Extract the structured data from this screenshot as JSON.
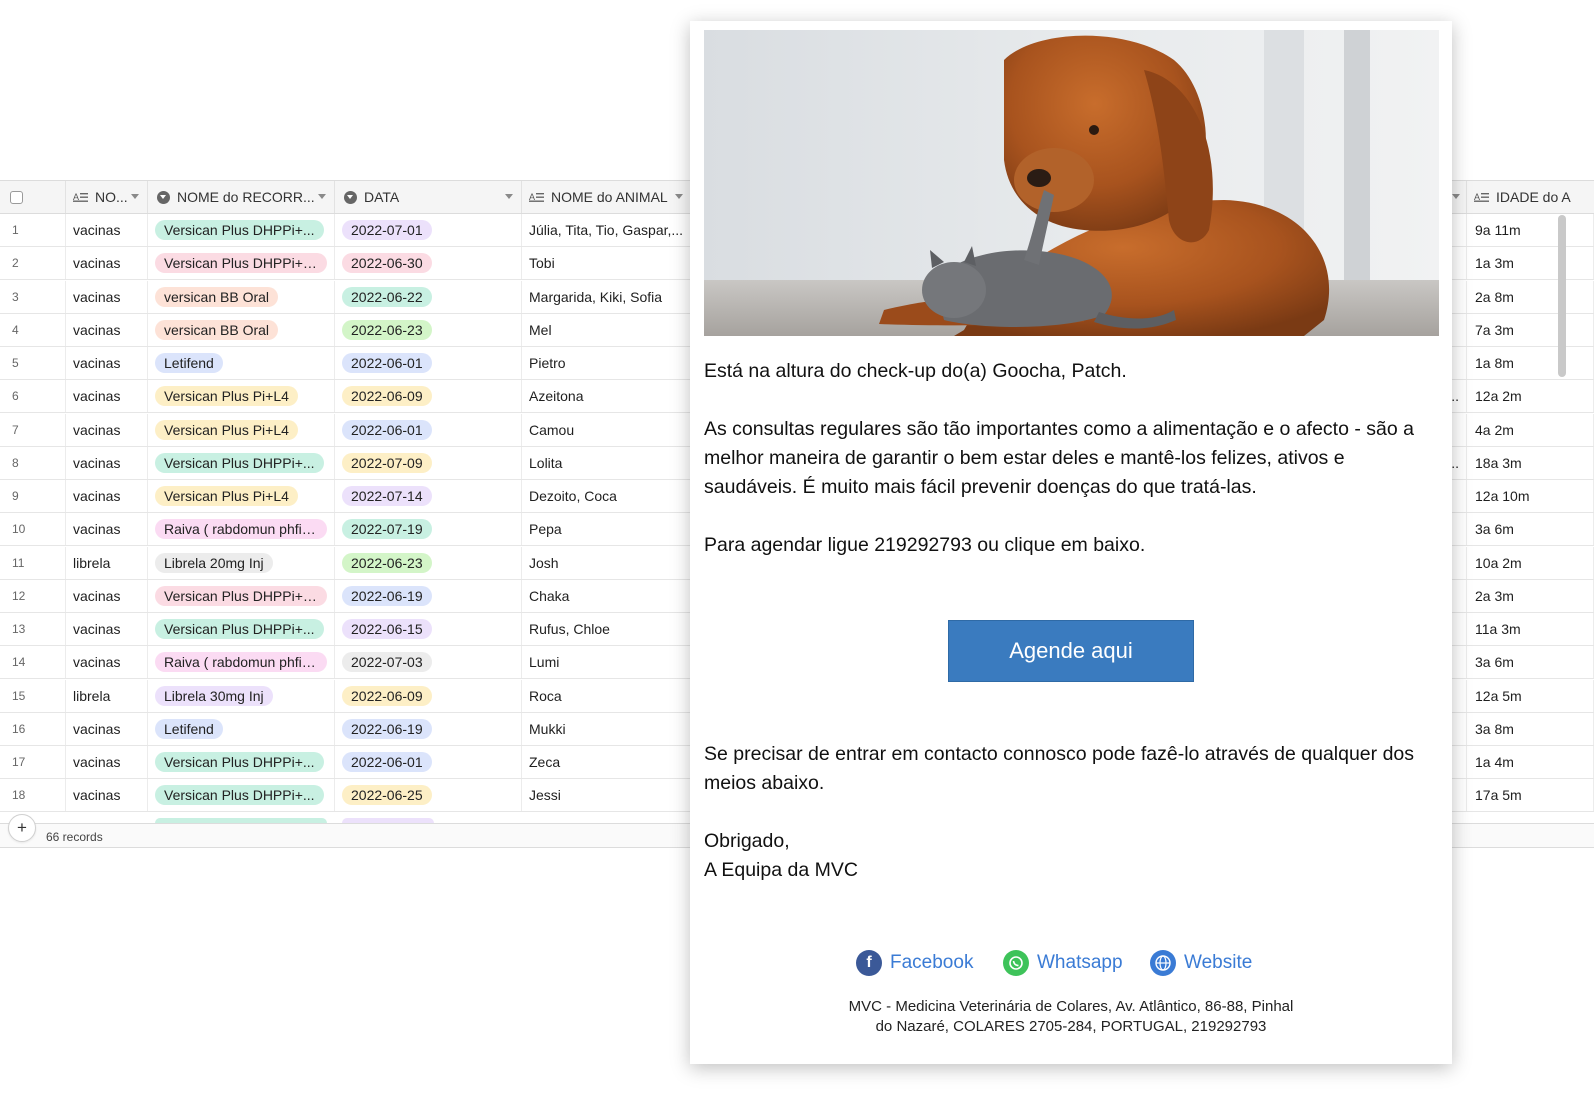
{
  "grid": {
    "headers": {
      "nome": "NO...",
      "recorrencia": "NOME do RECORR...",
      "data": "DATA",
      "animal": "NOME do ANIMAL",
      "idade": "IDADE do A"
    },
    "rows": [
      {
        "n": "1",
        "nome": "vacinas",
        "rec": "Versican Plus DHPPi+...",
        "rec_color": "#c8f0e2",
        "data": "2022-07-01",
        "data_color": "#ece1fb",
        "animal": "Júlia, Tita, Tio, Gaspar,...",
        "idade": "9a 11m",
        "gap": ""
      },
      {
        "n": "2",
        "nome": "vacinas",
        "rec": "Versican Plus DHPPi+L4",
        "rec_color": "#fbdbe3",
        "data": "2022-06-30",
        "data_color": "#fbdbe3",
        "animal": "Tobi",
        "idade": "1a 3m",
        "gap": ""
      },
      {
        "n": "3",
        "nome": "vacinas",
        "rec": "versican BB Oral",
        "rec_color": "#fde2d7",
        "data": "2022-06-22",
        "data_color": "#c8f0e2",
        "animal": "Margarida, Kiki, Sofia",
        "idade": "2a 8m",
        "gap": ""
      },
      {
        "n": "4",
        "nome": "vacinas",
        "rec": "versican BB Oral",
        "rec_color": "#fde2d7",
        "data": "2022-06-23",
        "data_color": "#d3f5c8",
        "animal": "Mel",
        "idade": "7a 3m",
        "gap": ""
      },
      {
        "n": "5",
        "nome": "vacinas",
        "rec": "Letifend",
        "rec_color": "#dbe4fb",
        "data": "2022-06-01",
        "data_color": "#dbe4fb",
        "animal": "Pietro",
        "idade": "1a 8m",
        "gap": ""
      },
      {
        "n": "6",
        "nome": "vacinas",
        "rec": "Versican Plus Pi+L4",
        "rec_color": "#fdefc6",
        "data": "2022-06-09",
        "data_color": "#fdefc6",
        "animal": "Azeitona",
        "idade": "12a 2m",
        "gap": "n..."
      },
      {
        "n": "7",
        "nome": "vacinas",
        "rec": "Versican Plus Pi+L4",
        "rec_color": "#fdefc6",
        "data": "2022-06-01",
        "data_color": "#dbe4fb",
        "animal": "Camou",
        "idade": "4a 2m",
        "gap": ""
      },
      {
        "n": "8",
        "nome": "vacinas",
        "rec": "Versican Plus DHPPi+...",
        "rec_color": "#c8f0e2",
        "data": "2022-07-09",
        "data_color": "#fdefc6",
        "animal": "Lolita",
        "idade": "18a 3m",
        "gap": "S..."
      },
      {
        "n": "9",
        "nome": "vacinas",
        "rec": "Versican Plus Pi+L4",
        "rec_color": "#fdefc6",
        "data": "2022-07-14",
        "data_color": "#ece1fb",
        "animal": "Dezoito, Coca",
        "idade": "12a 10m",
        "gap": ""
      },
      {
        "n": "10",
        "nome": "vacinas",
        "rec": "Raiva ( rabdomun phfiz...",
        "rec_color": "#fbdbf3",
        "data": "2022-07-19",
        "data_color": "#c8f0e2",
        "animal": "Pepa",
        "idade": "3a 6m",
        "gap": ""
      },
      {
        "n": "11",
        "nome": "librela",
        "rec": "Librela 20mg Inj",
        "rec_color": "#ececec",
        "data": "2022-06-23",
        "data_color": "#d3f5c8",
        "animal": "Josh",
        "idade": "10a 2m",
        "gap": ""
      },
      {
        "n": "12",
        "nome": "vacinas",
        "rec": "Versican Plus DHPPi+L4",
        "rec_color": "#fbdbe3",
        "data": "2022-06-19",
        "data_color": "#dbe4fb",
        "animal": "Chaka",
        "idade": "2a 3m",
        "gap": ""
      },
      {
        "n": "13",
        "nome": "vacinas",
        "rec": "Versican Plus DHPPi+...",
        "rec_color": "#c8f0e2",
        "data": "2022-06-15",
        "data_color": "#ece1fb",
        "animal": "Rufus, Chloe",
        "idade": "11a 3m",
        "gap": ""
      },
      {
        "n": "14",
        "nome": "vacinas",
        "rec": "Raiva ( rabdomun phfiz...",
        "rec_color": "#fbdbf3",
        "data": "2022-07-03",
        "data_color": "#ececec",
        "animal": "Lumi",
        "idade": "3a 6m",
        "gap": ""
      },
      {
        "n": "15",
        "nome": "librela",
        "rec": "Librela 30mg Inj",
        "rec_color": "#ece1fb",
        "data": "2022-06-09",
        "data_color": "#fdefc6",
        "animal": "Roca",
        "idade": "12a 5m",
        "gap": ""
      },
      {
        "n": "16",
        "nome": "vacinas",
        "rec": "Letifend",
        "rec_color": "#dbe4fb",
        "data": "2022-06-19",
        "data_color": "#dbe4fb",
        "animal": "Mukki",
        "idade": "3a 8m",
        "gap": ""
      },
      {
        "n": "17",
        "nome": "vacinas",
        "rec": "Versican Plus DHPPi+...",
        "rec_color": "#c8f0e2",
        "data": "2022-06-01",
        "data_color": "#dbe4fb",
        "animal": "Zeca",
        "idade": "1a 4m",
        "gap": ""
      },
      {
        "n": "18",
        "nome": "vacinas",
        "rec": "Versican Plus DHPPi+...",
        "rec_color": "#c8f0e2",
        "data": "2022-06-25",
        "data_color": "#fdefc6",
        "animal": "Jessi",
        "idade": "17a 5m",
        "gap": ""
      }
    ],
    "footer": {
      "add_label": "+",
      "records": "66 records"
    }
  },
  "email": {
    "hero_alt": "golden retriever with kitten",
    "greeting": "Está na altura do check-up do(a) Goocha, Patch.",
    "paragraph1": "As consultas regulares são tão importantes como a alimentação e o afecto - são a melhor maneira de garantir o bem estar deles e mantê-los felizes, ativos e saudáveis. É muito mais fácil prevenir doenças do que tratá-las.",
    "paragraph2": "Para agendar ligue 219292793 ou clique em baixo.",
    "cta_label": "Agende aqui",
    "paragraph3": "Se precisar de entrar em contacto connosco pode fazê-lo através de qualquer dos meios abaixo.",
    "signoff1": "Obrigado,",
    "signoff2": "A Equipa da MVC",
    "social": {
      "facebook": "Facebook",
      "whatsapp": "Whatsapp",
      "website": "Website"
    },
    "address1": "MVC - Medicina Veterinária de Colares, Av. Atlântico, 86-88, Pinhal",
    "address2": "do Nazaré, COLARES 2705-284, PORTUGAL, 219292793"
  },
  "colors": {
    "cta": "#3a7bbf",
    "link": "#3a7bd5",
    "facebook": "#3b5998",
    "whatsapp": "#3ec35a",
    "website": "#3a7bd5"
  }
}
